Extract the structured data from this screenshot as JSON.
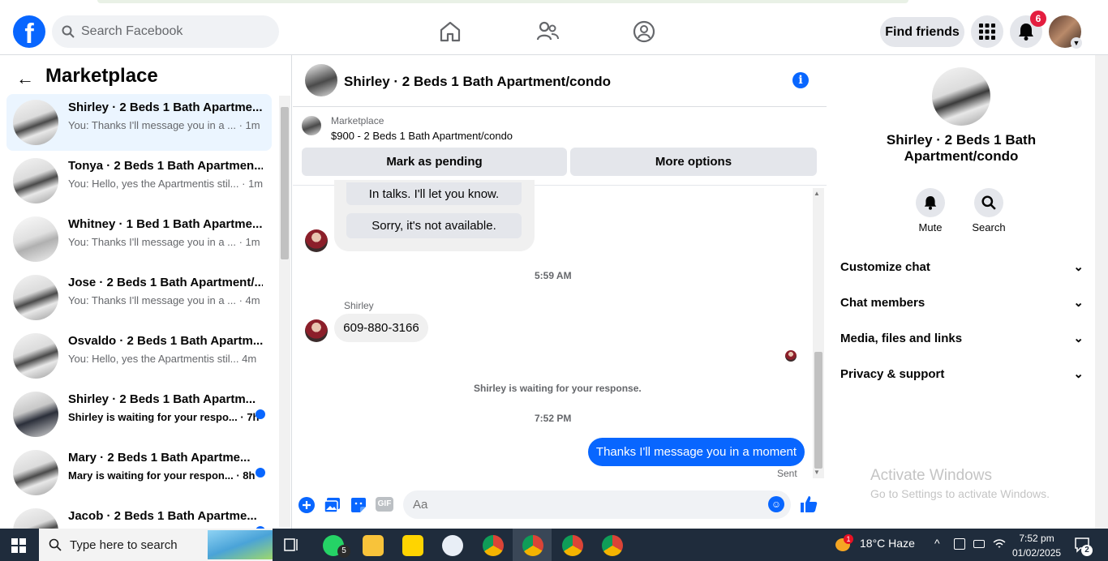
{
  "header": {
    "search_placeholder": "Search Facebook",
    "find_friends": "Find friends",
    "notif_count": "6"
  },
  "sidebar": {
    "title": "Marketplace",
    "conversations": [
      {
        "title": "Shirley · 2 Beds 1 Bath Apartme...",
        "sub": "You: Thanks I'll message you in a ... · 1m",
        "unread": false,
        "active": true
      },
      {
        "title": "Tonya · 2 Beds 1 Bath Apartmen...",
        "sub": "You: Hello, yes the Apartmentis stil... · 1m",
        "unread": false,
        "active": false
      },
      {
        "title": "Whitney · 1 Bed 1 Bath Apartme...",
        "sub": "You: Thanks I'll message you in a ... · 1m",
        "unread": false,
        "active": false
      },
      {
        "title": "Jose · 2 Beds 1 Bath Apartment/...",
        "sub": "You: Thanks I'll message you in a ... · 4m",
        "unread": false,
        "active": false
      },
      {
        "title": "Osvaldo · 2 Beds 1 Bath Apartm...",
        "sub": "You: Hello, yes the Apartmentis stil... 4m",
        "unread": false,
        "active": false
      },
      {
        "title": "Shirley · 2 Beds 1 Bath Apartm...",
        "sub": "Shirley is waiting for your respo... · 7h",
        "unread": true,
        "active": false
      },
      {
        "title": "Mary · 2 Beds 1 Bath Apartme...",
        "sub": "Mary is waiting for your respon... · 8h",
        "unread": true,
        "active": false
      },
      {
        "title": "Jacob · 2 Beds 1 Bath Apartme...",
        "sub": "",
        "unread": true,
        "active": false
      }
    ]
  },
  "chat": {
    "title": "Shirley · 2 Beds 1 Bath Apartment/condo",
    "marketplace_label": "Marketplace",
    "listing": "$900 - 2 Beds 1 Bath Apartment/condo",
    "mark_pending": "Mark as pending",
    "more_options": "More options",
    "quick_reply_1": "In talks. I'll let you know.",
    "quick_reply_2": "Sorry, it's not available.",
    "time_1": "5:59 AM",
    "sender": "Shirley",
    "phone_message": "609-880-3166",
    "waiting_notice": "Shirley is waiting for your response.",
    "time_2": "7:52 PM",
    "outgoing_message": "Thanks I'll message you in a moment",
    "sent_status": "Sent",
    "composer_placeholder": "Aa",
    "gif_label": "GIF"
  },
  "right_panel": {
    "title": "Shirley · 2 Beds 1 Bath Apartment/condo",
    "mute": "Mute",
    "search": "Search",
    "sections": [
      "Customize chat",
      "Chat members",
      "Media, files and links",
      "Privacy & support"
    ],
    "activate_title": "Activate Windows",
    "activate_sub": "Go to Settings to activate Windows."
  },
  "taskbar": {
    "search_placeholder": "Type here to search",
    "whatsapp_badge": "5",
    "weather_badge": "1",
    "weather": "18°C  Haze",
    "time": "7:52 pm",
    "date": "01/02/2025",
    "notif_count": "2"
  },
  "colors": {
    "accent": "#0866ff",
    "badge": "#e41e3f"
  }
}
